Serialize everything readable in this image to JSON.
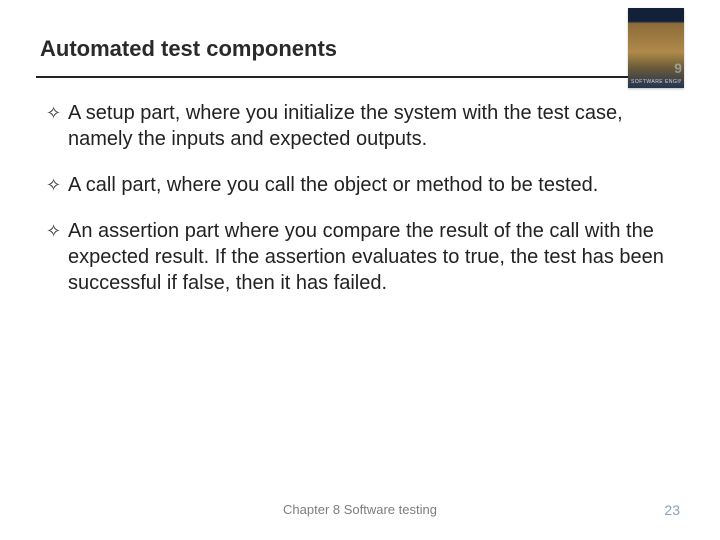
{
  "header": {
    "title": "Automated test components",
    "book_cover": {
      "subtitle_band": "SOFTWARE ENGINEERING",
      "edition_glyph": "9"
    }
  },
  "bullets": [
    "A setup part, where you initialize the system with the test case, namely the inputs and expected outputs.",
    "A call part, where you call the object or method to be tested.",
    "An assertion part where you compare the result of the call with the expected result. If the assertion evaluates to true, the test has been successful  if false, then it has failed."
  ],
  "footer": {
    "chapter": "Chapter 8 Software testing",
    "page_number": "23"
  },
  "bullet_marker": "✧"
}
